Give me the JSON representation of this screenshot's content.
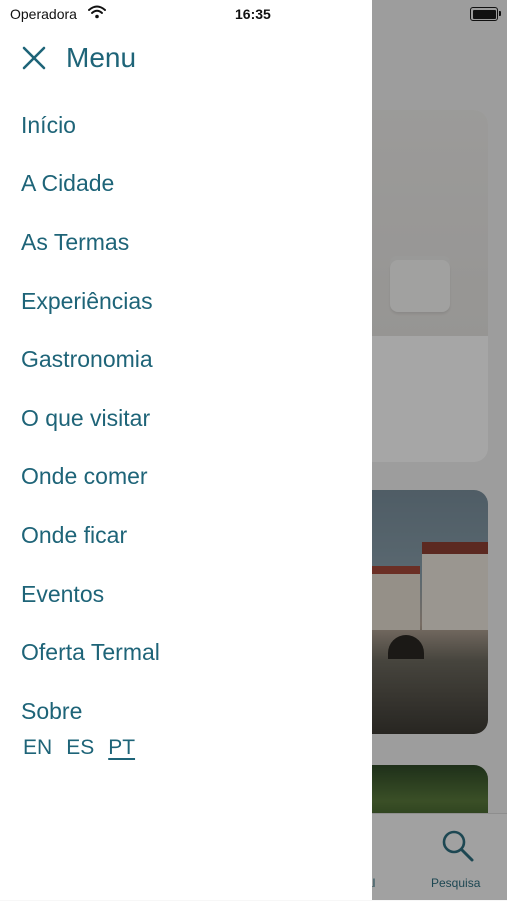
{
  "status_bar": {
    "carrier": "Operadora",
    "time": "16:35"
  },
  "menu": {
    "title": "Menu",
    "items": [
      {
        "label": "Início"
      },
      {
        "label": "A Cidade"
      },
      {
        "label": "As Termas"
      },
      {
        "label": "Experiências"
      },
      {
        "label": "Gastronomia"
      },
      {
        "label": "O que visitar"
      },
      {
        "label": "Onde comer"
      },
      {
        "label": "Onde ficar"
      },
      {
        "label": "Eventos"
      },
      {
        "label": "Oferta Termal"
      },
      {
        "label": "Sobre"
      }
    ],
    "languages": [
      {
        "code": "EN"
      },
      {
        "code": "ES"
      },
      {
        "code": "PT",
        "active": true
      }
    ]
  },
  "tab_bar": {
    "partial_label": "rmal",
    "search_label": "Pesquisa"
  },
  "colors": {
    "accent": "#1e6478",
    "drawer_bg": "#ffffff"
  }
}
